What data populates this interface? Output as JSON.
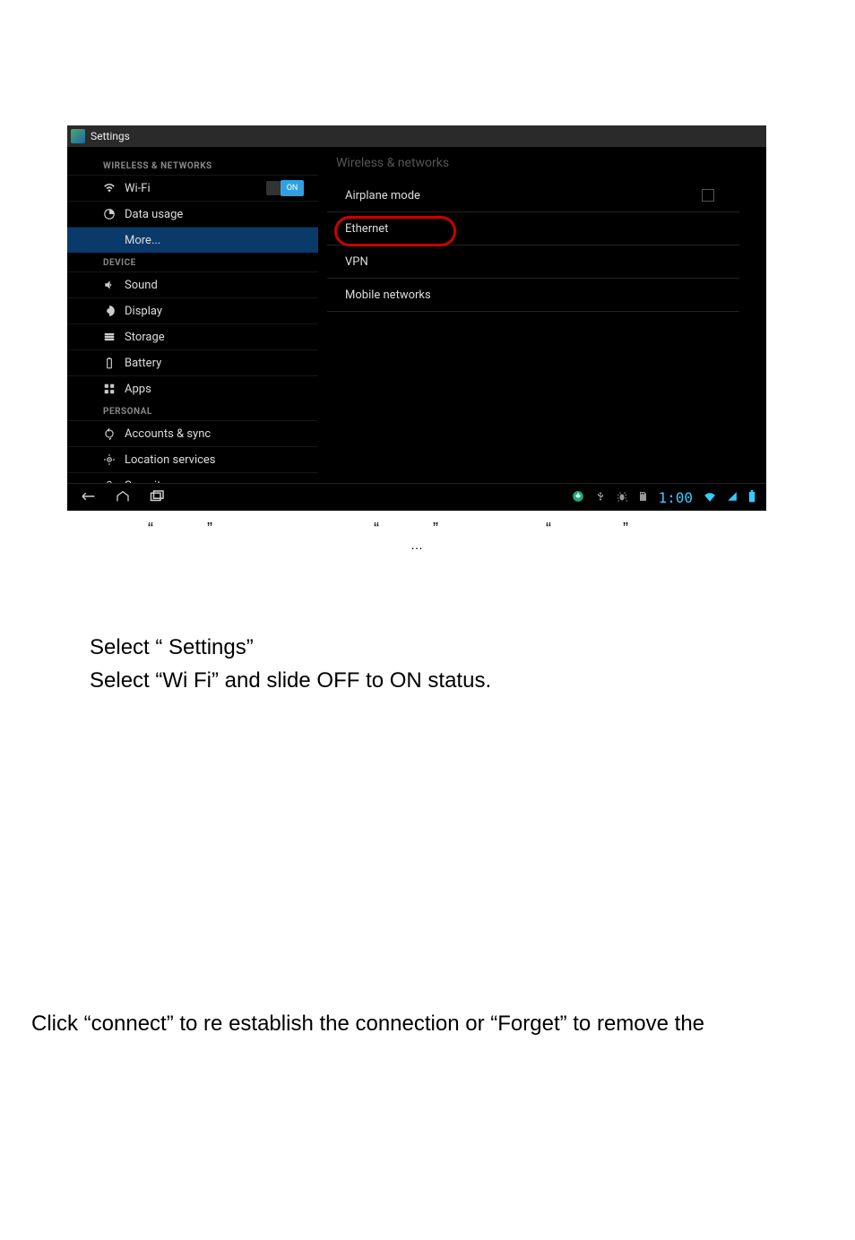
{
  "titlebar": {
    "label": "Settings"
  },
  "left_sections": {
    "wireless_header": "WIRELESS & NETWORKS",
    "wifi": {
      "label": "Wi-Fi",
      "toggle_text": "ON"
    },
    "data_usage": {
      "label": "Data usage"
    },
    "more": {
      "label": "More..."
    },
    "device_header": "DEVICE",
    "sound": {
      "label": "Sound"
    },
    "display": {
      "label": "Display"
    },
    "storage": {
      "label": "Storage"
    },
    "battery": {
      "label": "Battery"
    },
    "apps": {
      "label": "Apps"
    },
    "personal_header": "PERSONAL",
    "accounts": {
      "label": "Accounts & sync"
    },
    "location": {
      "label": "Location services"
    },
    "security": {
      "label": "Security"
    }
  },
  "right_panel": {
    "header": "Wireless & networks",
    "airplane": "Airplane mode",
    "ethernet": "Ethernet",
    "vpn": "VPN",
    "mobile": "Mobile networks"
  },
  "sysbar": {
    "clock": "1:00"
  },
  "caption": {
    "q1": "“",
    "q2": "”",
    "q3": "“",
    "q4": "”",
    "q5": "“",
    "q6": "”",
    "dots": "…"
  },
  "body": {
    "line1": "Select “ Settings”",
    "line2": "Select “Wi Fi” and slide OFF to ON status.",
    "line3": "Click “connect” to re establish the connection or “Forget” to remove the"
  }
}
